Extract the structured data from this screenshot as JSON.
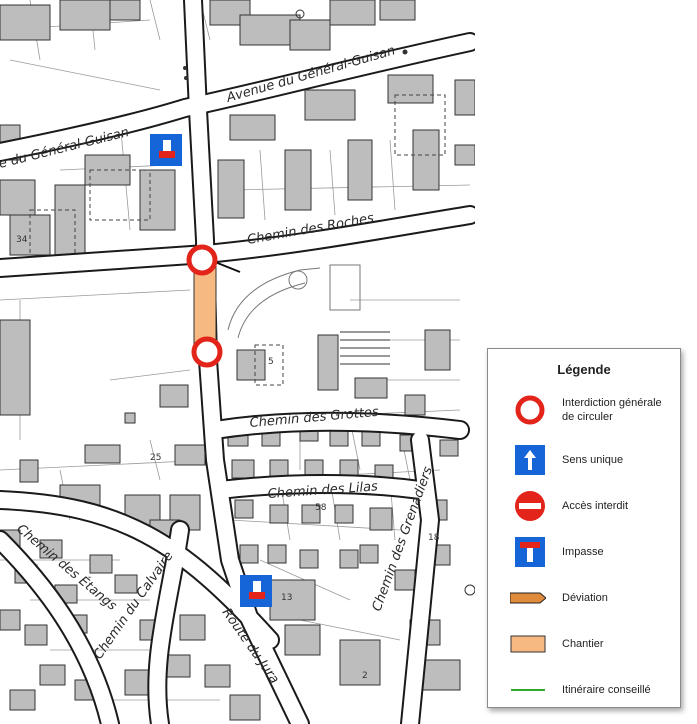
{
  "streets": {
    "avenue_general_guisan_top": "Avenue du Général-Guisan",
    "avenue_general_guisan_left": "e du Général-Guisan",
    "chemin_des_roches": "Chemin des Roches",
    "chemin_des_grottes": "Chemin des Grottes",
    "chemin_des_lilas": "Chemin des Lilas",
    "chemin_des_grenadiers": "Chemin des Grenadiers",
    "chemin_des_etangs": "Chemin des Étangs",
    "chemin_du_calvaire": "Chemin du Calvaire",
    "route_du_jura": "Route du Jura"
  },
  "house_numbers": {
    "n5": "5",
    "n13": "13",
    "n2": "2",
    "n34": "34",
    "n25": "25",
    "n58": "58",
    "n18": "18"
  },
  "legend": {
    "title": "Légende",
    "items": [
      {
        "label": "Interdiction générale de circuler",
        "symbol": "no-traffic-sign-icon"
      },
      {
        "label": "Sens unique",
        "symbol": "one-way-sign-icon"
      },
      {
        "label": "Accès interdit",
        "symbol": "no-entry-sign-icon"
      },
      {
        "label": "Impasse",
        "symbol": "dead-end-sign-icon"
      },
      {
        "label": "Déviation",
        "symbol": "detour-arrow-icon"
      },
      {
        "label": "Chantier",
        "symbol": "construction-zone-icon"
      },
      {
        "label": "Itinéraire conseillé",
        "symbol": "recommended-route-icon"
      }
    ]
  },
  "colors": {
    "sign_red": "#e3241b",
    "sign_blue": "#1565d8",
    "detour_orange": "#e08a3c",
    "chantier_fill": "#f7b982",
    "route_green": "#2ea82e",
    "building": "#bdbdbd",
    "street_outline": "#1a1a1a"
  }
}
